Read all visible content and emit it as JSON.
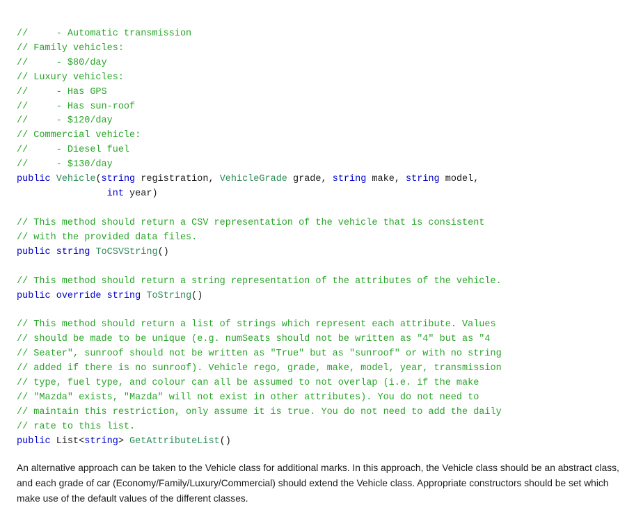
{
  "code": {
    "lines": []
  },
  "prose": {
    "text": "An alternative approach can be taken to the Vehicle class for additional marks. In this approach, the Vehicle class should be an abstract class, and each grade of car (Economy/Family/Luxury/Commercial) should extend the Vehicle class. Appropriate constructors should be set which make use of the default values of the different classes."
  }
}
